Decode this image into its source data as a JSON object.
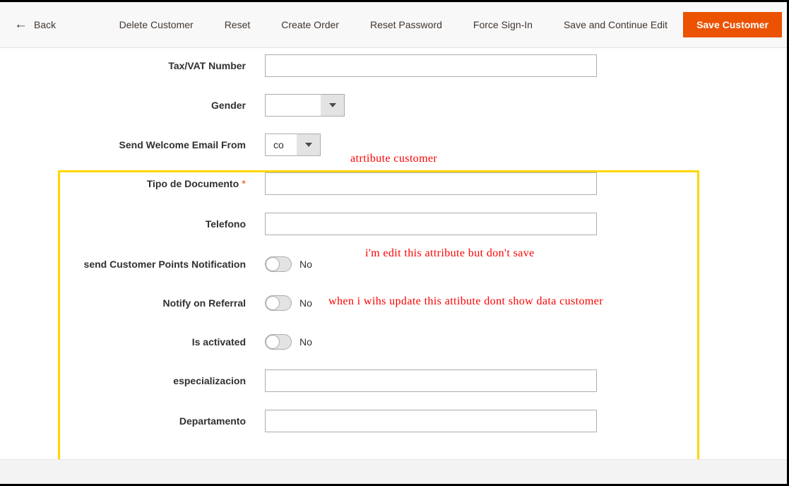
{
  "header": {
    "back_label": "Back",
    "back_icon": "arrow-left-icon",
    "buttons": [
      {
        "label": "Delete Customer",
        "name": "delete-customer-button"
      },
      {
        "label": "Reset",
        "name": "reset-button"
      },
      {
        "label": "Create Order",
        "name": "create-order-button"
      },
      {
        "label": "Reset Password",
        "name": "reset-password-button"
      },
      {
        "label": "Force Sign-In",
        "name": "force-sign-in-button"
      },
      {
        "label": "Save and Continue Edit",
        "name": "save-and-continue-edit-button"
      }
    ],
    "primary_button": "Save Customer",
    "primary_color": "#eb5202"
  },
  "form": {
    "tax_vat": {
      "label": "Tax/VAT Number",
      "value": "",
      "placeholder": ""
    },
    "gender": {
      "label": "Gender",
      "value": "",
      "arrow_icon": "chevron-down-icon"
    },
    "welcome_email": {
      "label": "Send Welcome Email From",
      "value": "co",
      "arrow_icon": "chevron-down-icon"
    },
    "tipo_documento": {
      "label": "Tipo de Documento",
      "required_marker": "*",
      "value": "",
      "placeholder": ""
    },
    "telefono": {
      "label": "Telefono",
      "value": "",
      "placeholder": ""
    },
    "points_notification": {
      "label": "send Customer Points Notification",
      "state": "No"
    },
    "notify_referral": {
      "label": "Notify on Referral",
      "state": "No"
    },
    "is_activated": {
      "label": "Is activated",
      "state": "No"
    },
    "especializacion": {
      "label": "especializacion",
      "value": "",
      "placeholder": ""
    },
    "departamento": {
      "label": "Departamento",
      "value": "",
      "placeholder": ""
    }
  },
  "annotations": {
    "top": "atrtibute  customer",
    "middle": "i'm  edit  this  attribute  but  don't  save",
    "bottom": "when  i  wihs  update  this  attibute  dont  show  data  customer",
    "color": "#fe0000",
    "highlight_color": "#ffd600"
  }
}
